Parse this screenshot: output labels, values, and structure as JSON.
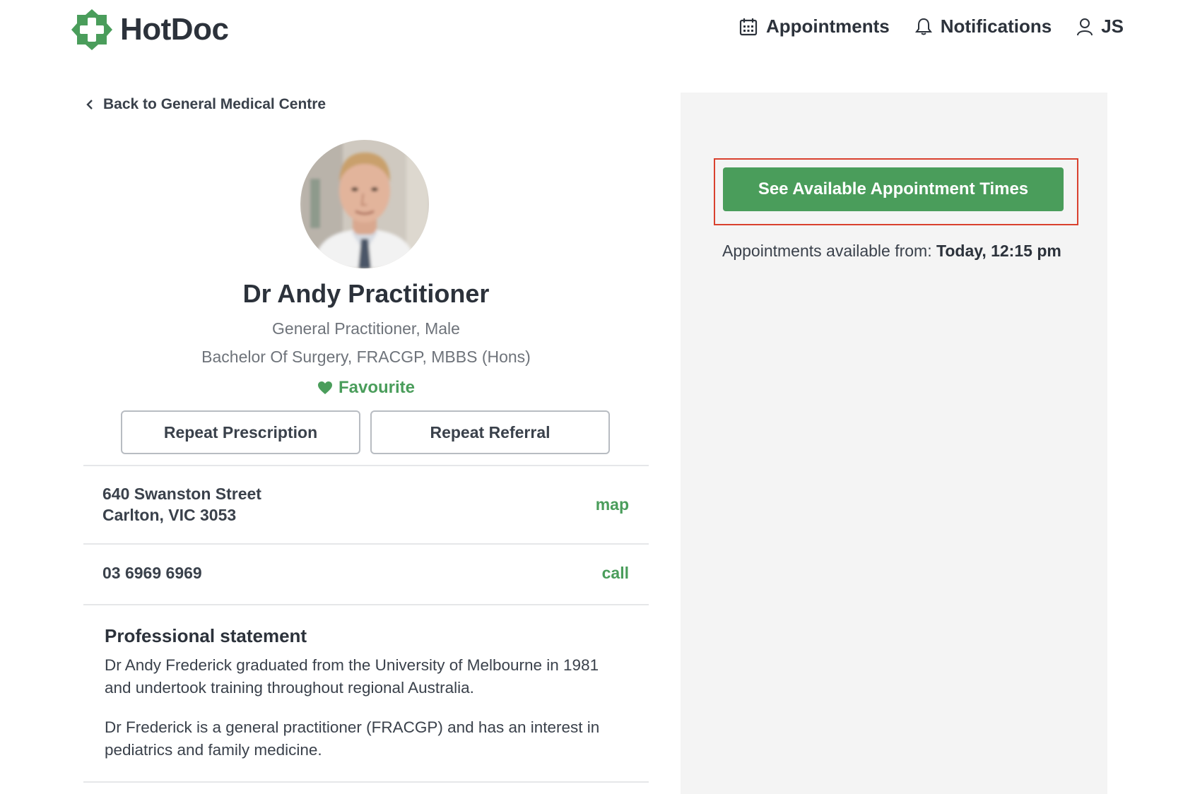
{
  "header": {
    "logo_text": "HotDoc",
    "nav": {
      "appointments": "Appointments",
      "notifications": "Notifications",
      "user_initials": "JS"
    }
  },
  "back_link": "Back to General Medical Centre",
  "doctor": {
    "name": "Dr Andy Practitioner",
    "role": "General Practitioner, Male",
    "qualifications": "Bachelor Of Surgery, FRACGP, MBBS (Hons)",
    "favourite_label": "Favourite"
  },
  "actions": {
    "repeat_prescription": "Repeat Prescription",
    "repeat_referral": "Repeat Referral"
  },
  "contact": {
    "address_line1": "640 Swanston Street",
    "address_line2": "Carlton, VIC 3053",
    "map_label": "map",
    "phone": "03 6969 6969",
    "call_label": "call"
  },
  "statement": {
    "title": "Professional statement",
    "paragraphs": [
      "Dr Andy Frederick graduated from the University of Melbourne in 1981 and undertook training throughout regional Australia.",
      "Dr Frederick is a general practitioner (FRACGP) and has an interest in pediatrics and family medicine."
    ]
  },
  "booking": {
    "button_label": "See Available Appointment Times",
    "available_prefix": "Appointments available from:",
    "available_value": "Today, 12:15 pm"
  },
  "colors": {
    "brand_green": "#4a9d5b",
    "highlight_red": "#d9412e",
    "panel_bg": "#f4f4f4"
  }
}
